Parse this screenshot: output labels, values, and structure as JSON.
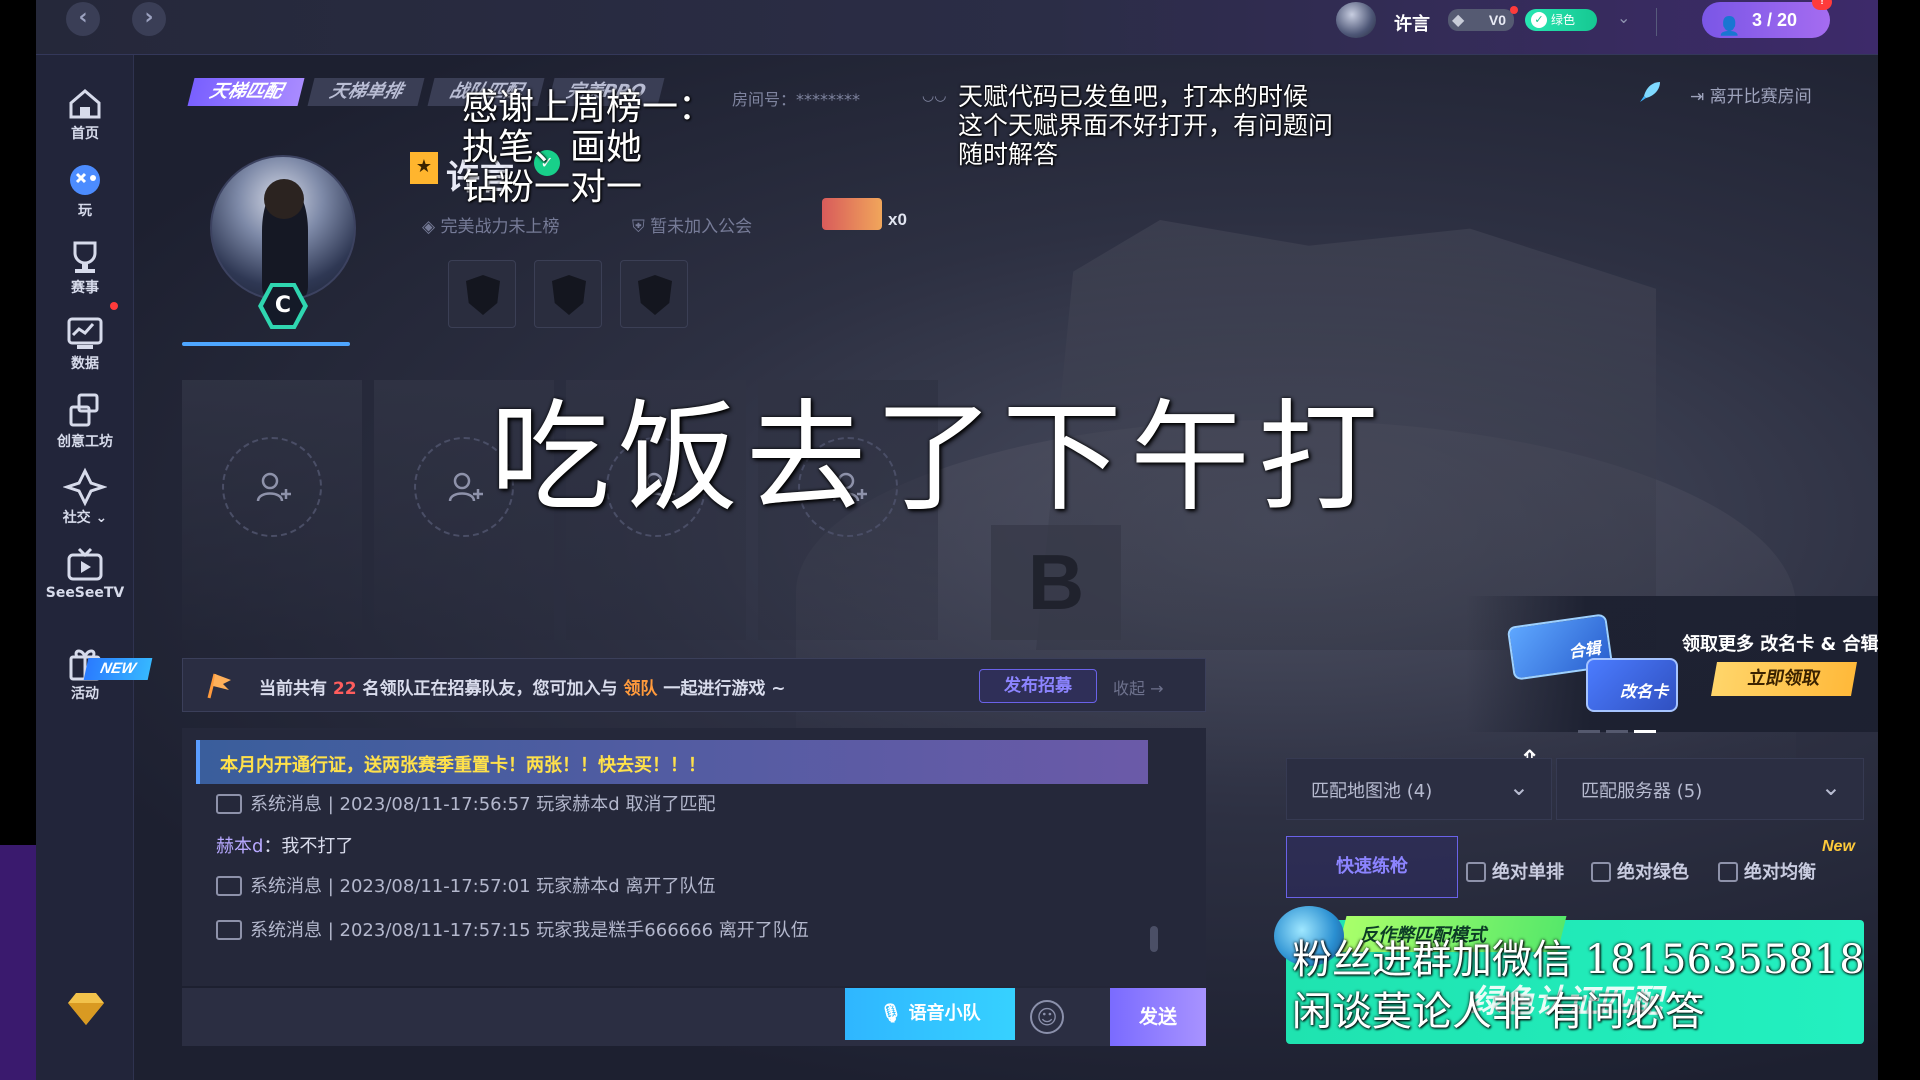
{
  "topbar": {
    "back": "‹",
    "forward": "›",
    "user_name": "许言",
    "vip_level": "V0",
    "green_label": "绿色",
    "team_count": "3 / 20",
    "team_badge": "!"
  },
  "sidebar": {
    "items": [
      {
        "label": "首页",
        "icon": "home-icon"
      },
      {
        "label": "玩",
        "icon": "gamepad-icon"
      },
      {
        "label": "赛事",
        "icon": "trophy-icon"
      },
      {
        "label": "数据",
        "icon": "chart-icon"
      },
      {
        "label": "创意工坊",
        "icon": "workshop-icon"
      },
      {
        "label": "社交 ⌄",
        "icon": "social-icon"
      },
      {
        "label": "SeeSeeTV",
        "icon": "tv-icon"
      },
      {
        "label": "活动",
        "icon": "gift-icon"
      }
    ],
    "new_badge": "NEW"
  },
  "room": {
    "mode_tabs": [
      "天梯匹配",
      "天梯单排",
      "战队匹配",
      "完美PRO"
    ],
    "room_number": "房间号：********",
    "leave_room": "离开比赛房间"
  },
  "profile": {
    "rank_letter": "C",
    "name": "许言",
    "power_rank": "完美战力未上榜",
    "guild": "暂未加入公会",
    "ticket_count": "x0"
  },
  "overlays": {
    "big": "吃饭去了下午打",
    "top_left": [
      "感谢上周榜一：",
      "执笔、画她",
      "钻粉一对一"
    ],
    "top_right": [
      "天赋代码已发鱼吧，打本的时候",
      "这个天赋界面不好打开，有问题问",
      "随时解答"
    ],
    "bottom_right": [
      "粉丝进群加微信 18156355818",
      "闲谈莫论人非            有问必答"
    ]
  },
  "recruit": {
    "prefix": "当前共有 ",
    "count": "22",
    "middle": " 名领队正在招募队友，您可加入与 ",
    "leader": "领队",
    "suffix": " 一起进行游戏 ~",
    "post_button": "发布招募",
    "collapse": "收起 →"
  },
  "chat": {
    "banner": "本月内开通行证，送两张赛季重置卡！两张！！快去买！！！",
    "messages": [
      "系统消息 | 2023/08/11-17:56:57 玩家赫本d 取消了匹配",
      "系统消息 | 2023/08/11-17:57:01 玩家赫本d 离开了队伍",
      "系统消息 | 2023/08/11-17:57:15 玩家我是糕手666666 离开了队伍"
    ],
    "user_name": "赫本d",
    "user_text": "：我不打了",
    "voice_button": "语音小队",
    "send_button": "发送"
  },
  "right_panel": {
    "promo_card1": "合辑",
    "promo_card2": "改名卡",
    "promo_text": "领取更多 改名卡 & 合辑",
    "promo_button": "立即领取",
    "map_pool": "匹配地图池 (4)",
    "server": "匹配服务器 (5)",
    "practice": "快速练枪",
    "checks": [
      "绝对单排",
      "绝对绿色",
      "绝对均衡"
    ],
    "new_tag": "New",
    "match_tag": "反作弊匹配模式",
    "match_label": "绿色认证匹配"
  },
  "colors": {
    "accent_purple": "#8c84ff",
    "accent_green": "#1fe3b0",
    "accent_blue": "#36d1ff",
    "warning_yellow": "#ffe14a"
  }
}
